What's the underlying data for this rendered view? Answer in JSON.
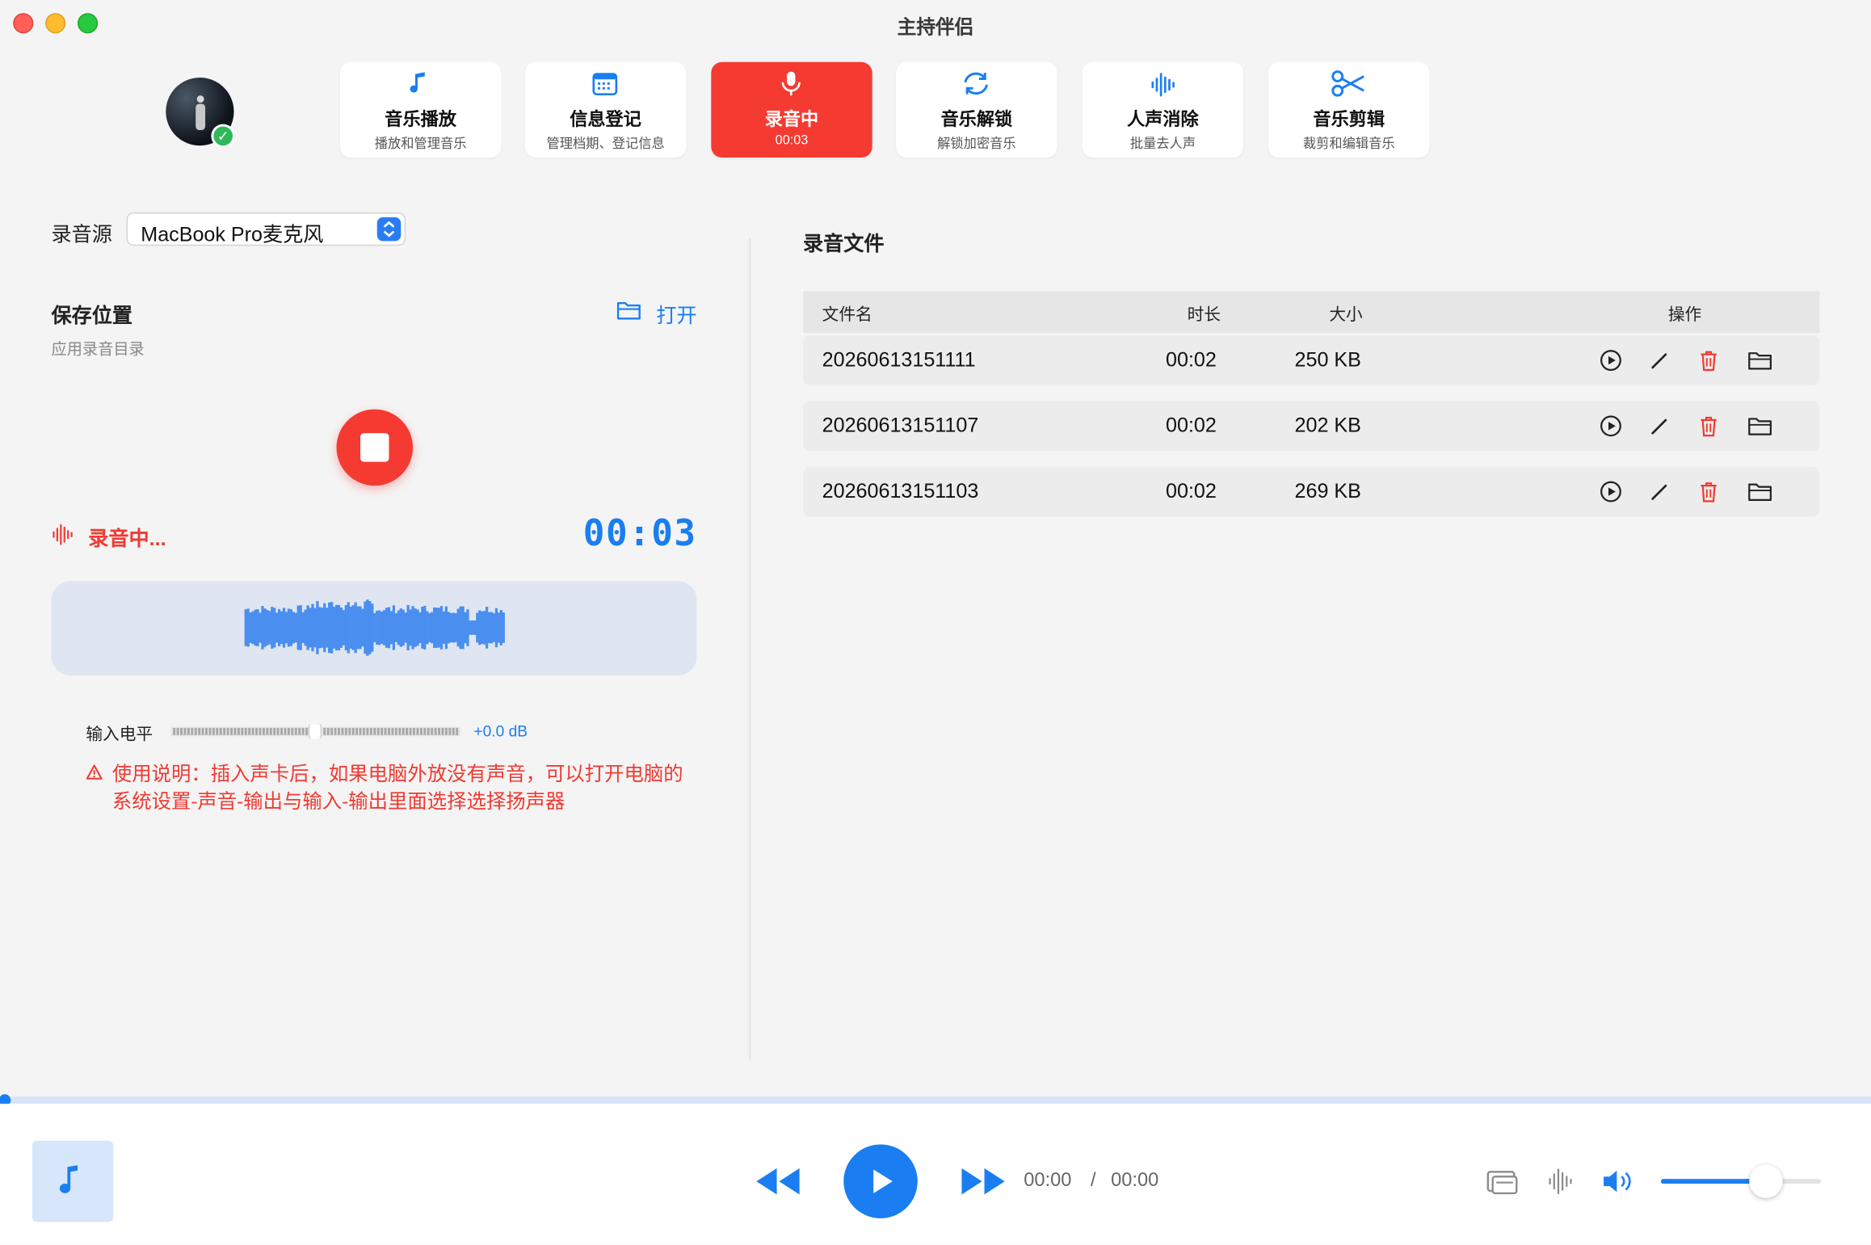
{
  "window": {
    "title": "主持伴侣"
  },
  "nav": [
    {
      "id": "music-play",
      "label": "音乐播放",
      "sub": "播放和管理音乐",
      "icon": "music-note-icon",
      "active": false
    },
    {
      "id": "info-register",
      "label": "信息登记",
      "sub": "管理档期、登记信息",
      "icon": "calendar-icon",
      "active": false
    },
    {
      "id": "recording",
      "label": "录音中",
      "sub": "00:03",
      "icon": "microphone-icon",
      "active": true
    },
    {
      "id": "music-unlock",
      "label": "音乐解锁",
      "sub": "解锁加密音乐",
      "icon": "sync-icon",
      "active": false
    },
    {
      "id": "vocal-remove",
      "label": "人声消除",
      "sub": "批量去人声",
      "icon": "waveform-icon",
      "active": false
    },
    {
      "id": "music-edit",
      "label": "音乐剪辑",
      "sub": "裁剪和编辑音乐",
      "icon": "scissors-icon",
      "active": false
    }
  ],
  "recorder": {
    "source_label": "录音源",
    "source_value": "MacBook Pro麦克风",
    "save_title": "保存位置",
    "save_sub": "应用录音目录",
    "open_label": "打开",
    "status": "录音中...",
    "elapsed": "00:03",
    "level_label": "输入电平",
    "level_db": "+0.0 dB",
    "level_value": 0.5,
    "notice": "使用说明：插入声卡后，如果电脑外放没有声音，可以打开电脑的系统设置-声音-输出与输入-输出里面选择选择扬声器"
  },
  "files": {
    "title": "录音文件",
    "columns": [
      "文件名",
      "时长",
      "大小",
      "操作"
    ],
    "rows": [
      {
        "name": "20260613151111",
        "duration": "00:02",
        "size": "250 KB"
      },
      {
        "name": "20260613151107",
        "duration": "00:02",
        "size": "202 KB"
      },
      {
        "name": "20260613151103",
        "duration": "00:02",
        "size": "269 KB"
      }
    ],
    "actions": [
      "play-icon",
      "edit-icon",
      "delete-icon",
      "folder-icon"
    ]
  },
  "player": {
    "current": "00:00",
    "separator": "/",
    "total": "00:00",
    "progress": 0,
    "volume": 0.66
  },
  "colors": {
    "accent": "#1a7ef2",
    "record": "#f53a31",
    "wave": "#4a8ef0"
  }
}
